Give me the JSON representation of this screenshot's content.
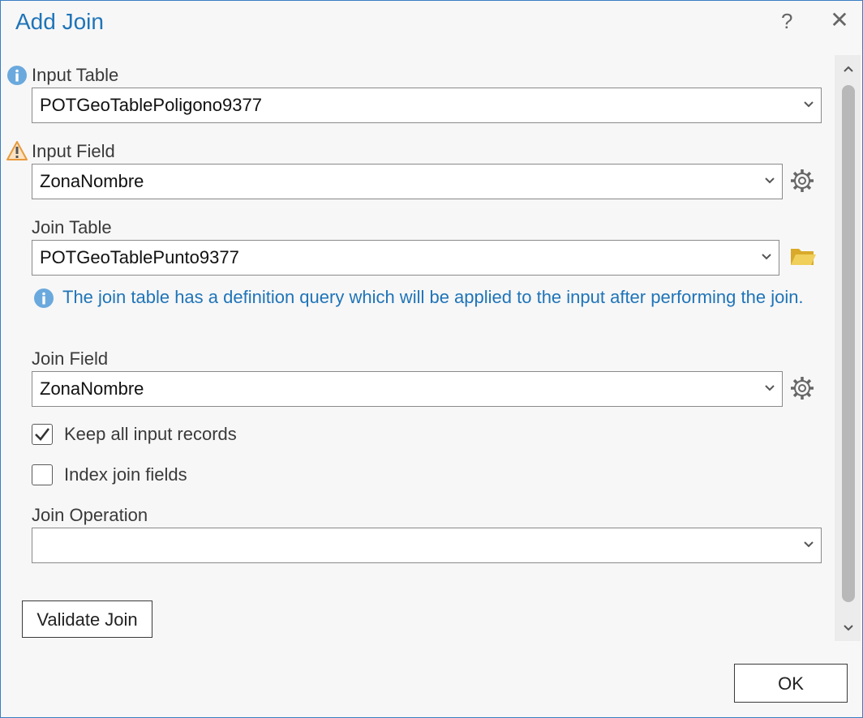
{
  "dialog": {
    "title": "Add Join",
    "help_label": "?",
    "close_label": "✕"
  },
  "input_table": {
    "label": "Input Table",
    "value": "POTGeoTablePoligono9377"
  },
  "input_field": {
    "label": "Input Field",
    "value": "ZonaNombre"
  },
  "join_table": {
    "label": "Join Table",
    "value": "POTGeoTablePunto9377",
    "info_message": "The join table has a definition query which will be applied to the input after performing the join."
  },
  "join_field": {
    "label": "Join Field",
    "value": "ZonaNombre"
  },
  "options": {
    "keep_all_label": "Keep all input records",
    "keep_all_checked": true,
    "index_label": "Index join fields",
    "index_checked": false
  },
  "join_operation": {
    "label": "Join Operation",
    "value": ""
  },
  "buttons": {
    "validate_label": "Validate Join",
    "ok_label": "OK"
  },
  "colors": {
    "accent": "#1f74b8",
    "info_icon": "#6aa9dd",
    "warning_icon": "#e89a3c",
    "folder_icon": "#e2b93b"
  },
  "icons": [
    "info-icon",
    "warning-icon",
    "chevron-down-icon",
    "gear-icon",
    "folder-icon",
    "checkmark-icon",
    "chevron-up-icon",
    "close-icon",
    "help-icon"
  ]
}
